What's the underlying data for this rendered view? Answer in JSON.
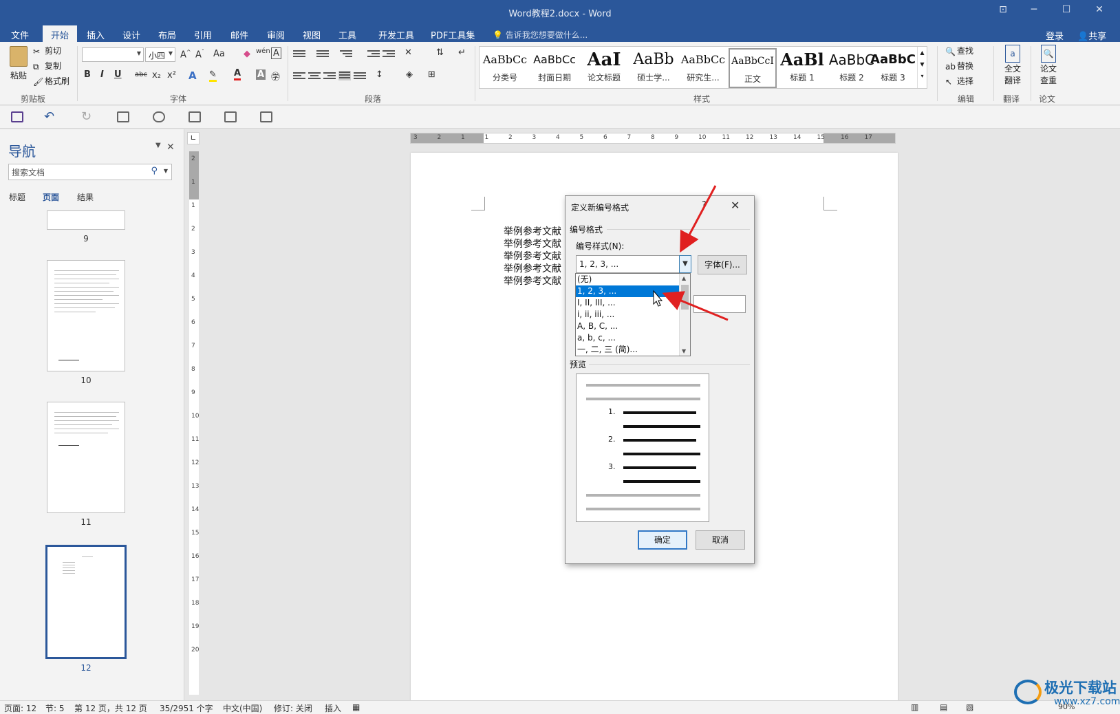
{
  "window": {
    "title": "Word教程2.docx - Word",
    "controls": [
      "restore-ribbon-icon",
      "minimize-icon",
      "maximize-icon",
      "close-icon"
    ]
  },
  "menu": {
    "tabs": [
      "文件",
      "开始",
      "插入",
      "设计",
      "布局",
      "引用",
      "邮件",
      "审阅",
      "视图",
      "工具",
      "开发工具",
      "PDF工具集"
    ],
    "active_tab": "开始",
    "tell_me": "告诉我您想要做什么...",
    "login": "登录",
    "share": "共享"
  },
  "ribbon": {
    "clipboard": {
      "paste": "粘贴",
      "cut": "剪切",
      "copy": "复制",
      "format_painter": "格式刷",
      "label": "剪贴板"
    },
    "font": {
      "font_name": "",
      "font_size": "小四",
      "case_btn": "Aa",
      "label": "字体",
      "bold": "B",
      "italic": "I",
      "underline": "U",
      "strike": "abc",
      "sub": "x₂",
      "sup": "x²",
      "phonetic": "wén",
      "border_char": "A"
    },
    "paragraph": {
      "label": "段落"
    },
    "styles": {
      "label": "样式",
      "items": [
        {
          "sample": "AaBbCc",
          "name": "分类号"
        },
        {
          "sample": "AaBbCc",
          "name": "封面日期"
        },
        {
          "sample": "AaI",
          "name": "论文标题"
        },
        {
          "sample": "AaBb",
          "name": "硕士学..."
        },
        {
          "sample": "AaBbCc",
          "name": "研究生..."
        },
        {
          "sample": "AaBbCcI",
          "name": "正文"
        },
        {
          "sample": "AaBl",
          "name": "标题 1"
        },
        {
          "sample": "AaBbC",
          "name": "标题 2"
        },
        {
          "sample": "AaBbC",
          "name": "标题 3"
        }
      ],
      "selected": "正文"
    },
    "editing": {
      "find": "查找",
      "replace": "替换",
      "select": "选择",
      "label": "编辑"
    },
    "translate": {
      "full": "全文",
      "full2": "翻译",
      "label": "翻译"
    },
    "thesis": {
      "check": "论文",
      "check2": "查重",
      "label": "论文"
    }
  },
  "nav": {
    "title": "导航",
    "search_placeholder": "搜索文档",
    "tabs": [
      "标题",
      "页面",
      "结果"
    ],
    "active_tab": "页面",
    "pages": [
      "9",
      "10",
      "11",
      "12"
    ],
    "selected_page": "12"
  },
  "ruler": {
    "h_numbers": [
      "3",
      "2",
      "1",
      "1",
      "2",
      "3",
      "4",
      "5",
      "6",
      "7",
      "8",
      "9",
      "10",
      "11",
      "12",
      "13",
      "14",
      "15",
      "16",
      "17"
    ],
    "v_numbers": [
      "2",
      "1",
      "1",
      "2",
      "3",
      "4",
      "5",
      "6",
      "7",
      "8",
      "9",
      "10",
      "11",
      "12",
      "13",
      "14",
      "15",
      "16",
      "17",
      "18",
      "19",
      "20"
    ]
  },
  "document": {
    "lines": [
      "举例参考文献",
      "举例参考文献",
      "举例参考文献",
      "举例参考文献",
      "举例参考文献"
    ]
  },
  "dialog": {
    "title": "定义新编号格式",
    "help": "?",
    "section_format": "编号格式",
    "number_style_label": "编号样式(N):",
    "selected_style": "1, 2, 3, ...",
    "font_button": "字体(F)...",
    "dropdown_options": [
      "(无)",
      "1, 2, 3, ...",
      "I, II, III, ...",
      "i, ii, iii, ...",
      "A, B, C, ...",
      "a, b, c, ...",
      "一, 二, 三 (简)..."
    ],
    "highlighted_option": "1, 2, 3, ...",
    "section_preview": "预览",
    "preview_numbers": [
      "1.",
      "2.",
      "3."
    ],
    "ok": "确定",
    "cancel": "取消"
  },
  "statusbar": {
    "page": "页面: 12",
    "section": "节: 5",
    "page_of": "第 12 页，共 12 页",
    "words": "35/2951 个字",
    "language": "中文(中国)",
    "track": "修订: 关闭",
    "insert": "插入",
    "zoom": "90%"
  },
  "watermark": {
    "brand": "极光下载站",
    "url": "www.xz7.com"
  },
  "colors": {
    "brand": "#2b579a",
    "highlight": "#0078d7",
    "arrow": "#e02020"
  }
}
